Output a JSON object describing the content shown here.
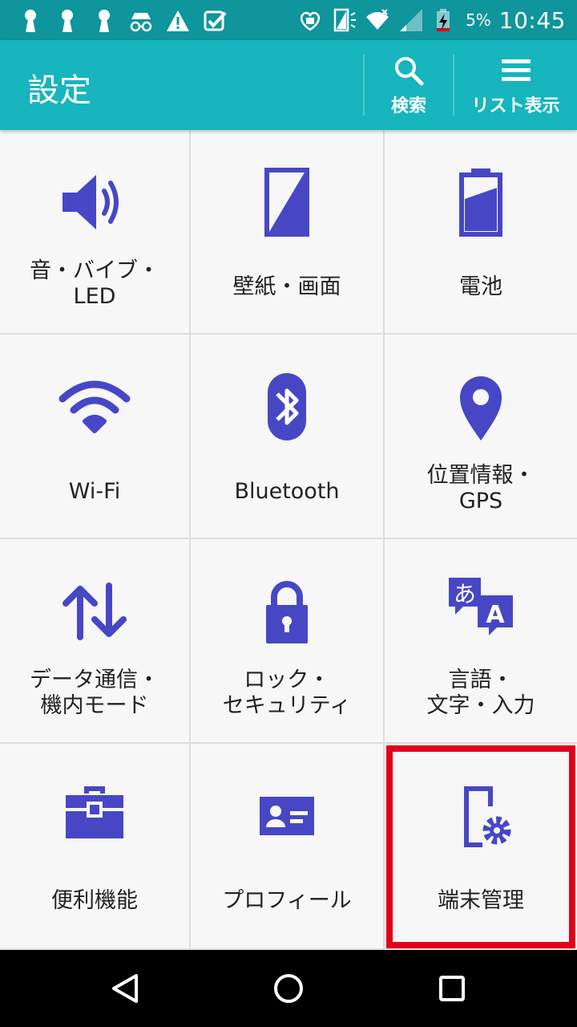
{
  "status_bar": {
    "left_icons": [
      "keyhole-icon",
      "keyhole-icon",
      "keyhole-icon",
      "incognito-icon",
      "warning-icon",
      "check-app-icon"
    ],
    "right_icons": [
      "heart-face-icon",
      "screen-rotate-icon",
      "wifi-icon",
      "signal-icon",
      "battery-charging-icon"
    ],
    "battery_percent": "5%",
    "time": "10:45"
  },
  "app_bar": {
    "title": "設定",
    "search_label": "検索",
    "list_view_label": "リスト表示"
  },
  "tiles": [
    {
      "icon": "volume-icon",
      "label": "音・バイブ・\nLED"
    },
    {
      "icon": "wallpaper-icon",
      "label": "壁紙・画面"
    },
    {
      "icon": "battery-icon",
      "label": "電池"
    },
    {
      "icon": "wifi-icon",
      "label": "Wi-Fi"
    },
    {
      "icon": "bluetooth-icon",
      "label": "Bluetooth"
    },
    {
      "icon": "location-pin-icon",
      "label": "位置情報・\nGPS"
    },
    {
      "icon": "data-transfer-icon",
      "label": "データ通信・\n機内モード"
    },
    {
      "icon": "lock-icon",
      "label": "ロック・\nセキュリティ"
    },
    {
      "icon": "translate-icon",
      "label": "言語・\n文字・入力"
    },
    {
      "icon": "toolbox-icon",
      "label": "便利機能"
    },
    {
      "icon": "profile-card-icon",
      "label": "プロフィール"
    },
    {
      "icon": "device-settings-icon",
      "label": "端末管理"
    }
  ],
  "colors": {
    "status_bar": "#0f959c",
    "app_bar": "#17b5bd",
    "icon": "#4747c6",
    "highlight_border": "#e2001b",
    "nav_bar": "#000000"
  },
  "nav_bar": [
    "back-icon",
    "home-icon",
    "recents-icon"
  ]
}
